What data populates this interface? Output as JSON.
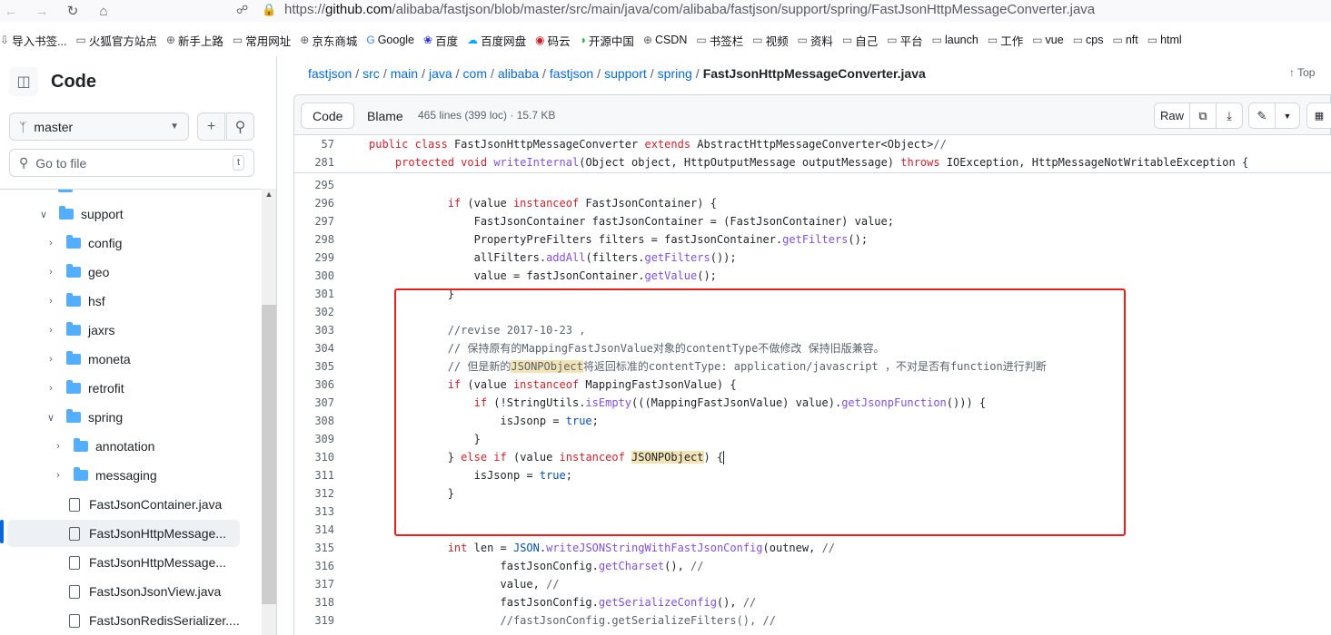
{
  "browser": {
    "url_prefix": "https://",
    "url_host": "github.com",
    "url_path": "/alibaba/fastjson/blob/master/src/main/java/com/alibaba/fastjson/support/spring/FastJsonHttpMessageConverter.java",
    "bookmarks": [
      {
        "label": "导入书签...",
        "icon": "import-icon"
      },
      {
        "label": "火狐官方站点",
        "icon": "folder-icon"
      },
      {
        "label": "新手上路",
        "icon": "globe-icon"
      },
      {
        "label": "常用网址",
        "icon": "folder-icon"
      },
      {
        "label": "京东商城",
        "icon": "globe-icon"
      },
      {
        "label": "Google",
        "icon": "google-icon"
      },
      {
        "label": "百度",
        "icon": "baidu-icon"
      },
      {
        "label": "百度网盘",
        "icon": "cloud-icon"
      },
      {
        "label": "码云",
        "icon": "gitee-icon"
      },
      {
        "label": "开源中国",
        "icon": "oschina-icon"
      },
      {
        "label": "CSDN",
        "icon": "globe-icon"
      },
      {
        "label": "书签栏",
        "icon": "folder-icon"
      },
      {
        "label": "视频",
        "icon": "folder-icon"
      },
      {
        "label": "资料",
        "icon": "folder-icon"
      },
      {
        "label": "自己",
        "icon": "folder-icon"
      },
      {
        "label": "平台",
        "icon": "folder-icon"
      },
      {
        "label": "launch",
        "icon": "folder-icon"
      },
      {
        "label": "工作",
        "icon": "folder-icon"
      },
      {
        "label": "vue",
        "icon": "folder-icon"
      },
      {
        "label": "cps",
        "icon": "folder-icon"
      },
      {
        "label": "nft",
        "icon": "folder-icon"
      },
      {
        "label": "html",
        "icon": "folder-icon"
      }
    ]
  },
  "sidebar": {
    "title": "Code",
    "branch": "master",
    "goto_placeholder": "Go to file",
    "goto_shortcut": "t",
    "tree": [
      {
        "label": "support",
        "type": "folder",
        "depth": 1,
        "expanded": true
      },
      {
        "label": "config",
        "type": "folder",
        "depth": 2,
        "expanded": false
      },
      {
        "label": "geo",
        "type": "folder",
        "depth": 2,
        "expanded": false
      },
      {
        "label": "hsf",
        "type": "folder",
        "depth": 2,
        "expanded": false
      },
      {
        "label": "jaxrs",
        "type": "folder",
        "depth": 2,
        "expanded": false
      },
      {
        "label": "moneta",
        "type": "folder",
        "depth": 2,
        "expanded": false
      },
      {
        "label": "retrofit",
        "type": "folder",
        "depth": 2,
        "expanded": false
      },
      {
        "label": "spring",
        "type": "folder",
        "depth": 2,
        "expanded": true
      },
      {
        "label": "annotation",
        "type": "folder",
        "depth": 3,
        "expanded": false
      },
      {
        "label": "messaging",
        "type": "folder",
        "depth": 3,
        "expanded": false
      },
      {
        "label": "FastJsonContainer.java",
        "type": "file",
        "depth": 3
      },
      {
        "label": "FastJsonHttpMessage...",
        "type": "file",
        "depth": 3,
        "active": true
      },
      {
        "label": "FastJsonHttpMessage...",
        "type": "file",
        "depth": 3
      },
      {
        "label": "FastJsonJsonView.java",
        "type": "file",
        "depth": 3
      },
      {
        "label": "FastJsonRedisSerializer....",
        "type": "file",
        "depth": 3
      }
    ]
  },
  "breadcrumb": {
    "parts": [
      "fastjson",
      "src",
      "main",
      "java",
      "com",
      "alibaba",
      "fastjson",
      "support",
      "spring"
    ],
    "current": "FastJsonHttpMessageConverter.java",
    "top_label": "Top"
  },
  "filebar": {
    "code_tab": "Code",
    "blame_tab": "Blame",
    "info": "465 lines (399 loc) · 15.7 KB",
    "raw_label": "Raw"
  },
  "code": {
    "sticky": [
      {
        "num": "57",
        "text": "public class FastJsonHttpMessageConverter extends AbstractHttpMessageConverter<Object>//"
      },
      {
        "num": "281",
        "text": "    protected void writeInternal(Object object, HttpOutputMessage outputMessage) throws IOException, HttpMessageNotWritableException {"
      }
    ],
    "lines": [
      {
        "num": "295",
        "text": ""
      },
      {
        "num": "296",
        "text": "            if (value instanceof FastJsonContainer) {"
      },
      {
        "num": "297",
        "text": "                FastJsonContainer fastJsonContainer = (FastJsonContainer) value;"
      },
      {
        "num": "298",
        "text": "                PropertyPreFilters filters = fastJsonContainer.getFilters();"
      },
      {
        "num": "299",
        "text": "                allFilters.addAll(filters.getFilters());"
      },
      {
        "num": "300",
        "text": "                value = fastJsonContainer.getValue();"
      },
      {
        "num": "301",
        "text": "            }"
      },
      {
        "num": "302",
        "text": ""
      },
      {
        "num": "303",
        "text": "            //revise 2017-10-23 ,"
      },
      {
        "num": "304",
        "text": "            // 保持原有的MappingFastJsonValue对象的contentType不做修改 保持旧版兼容。"
      },
      {
        "num": "305",
        "text": "            // 但是新的JSONPObject将返回标准的contentType: application/javascript ，不对是否有function进行判断"
      },
      {
        "num": "306",
        "text": "            if (value instanceof MappingFastJsonValue) {"
      },
      {
        "num": "307",
        "text": "                if (!StringUtils.isEmpty(((MappingFastJsonValue) value).getJsonpFunction())) {"
      },
      {
        "num": "308",
        "text": "                    isJsonp = true;"
      },
      {
        "num": "309",
        "text": "                }"
      },
      {
        "num": "310",
        "text": "            } else if (value instanceof JSONPObject) {"
      },
      {
        "num": "311",
        "text": "                isJsonp = true;"
      },
      {
        "num": "312",
        "text": "            }"
      },
      {
        "num": "313",
        "text": ""
      },
      {
        "num": "314",
        "text": ""
      },
      {
        "num": "315",
        "text": "            int len = JSON.writeJSONStringWithFastJsonConfig(outnew, //"
      },
      {
        "num": "316",
        "text": "                    fastJsonConfig.getCharset(), //"
      },
      {
        "num": "317",
        "text": "                    value, //"
      },
      {
        "num": "318",
        "text": "                    fastJsonConfig.getSerializeConfig(), //"
      },
      {
        "num": "319",
        "text": "                    //fastJsonConfig.getSerializeFilters(), //"
      }
    ]
  }
}
